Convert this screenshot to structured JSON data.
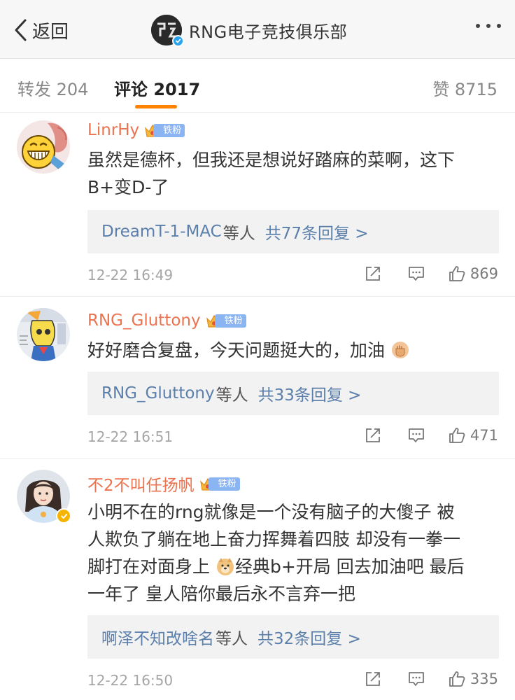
{
  "header": {
    "back_label": "返回",
    "title": "RNG电子竞技俱乐部",
    "avatar_text": "⨼",
    "more_icon": "ellipsis-icon"
  },
  "tabs": {
    "repost": "转发 204",
    "comment": "评论 2017",
    "likes": "赞 8715",
    "active_color": "#ff8200"
  },
  "colors": {
    "username": "#eb7350",
    "link": "#5b7fab",
    "fan_badge": "#8ab4f2",
    "verified": "#f5b400"
  },
  "comments": [
    {
      "user": "LinrHy",
      "badge": "铁粉",
      "text_lines": [
        "虽然是德杯，但我还是想说好踏麻的菜啊，这下",
        "B+变D-了"
      ],
      "reply_users": "DreamT-1-MAC",
      "reply_etc": "等人",
      "reply_count": "共77条回复 >",
      "time": "12-22 16:49",
      "likes": "869"
    },
    {
      "user": "RNG_Gluttony",
      "badge": "铁粉",
      "text_lines": [
        "好好磨合复盘，今天问题挺大的，加油"
      ],
      "reply_users": "RNG_Gluttony",
      "reply_etc": "等人",
      "reply_count": "共33条回复 >",
      "time": "12-22 16:51",
      "likes": "471"
    },
    {
      "user": "不2不叫任扬帆",
      "badge": "铁粉",
      "text_lines": [
        "小明不在的rng就像是一个没有脑子的大傻子 被",
        "人欺负了躺在地上奋力挥舞着四肢 却没有一拳一",
        "脚打在对面身上",
        "经典b+开局 回去加油吧 最后",
        "一年了 皇人陪你最后永不言弃一把"
      ],
      "reply_users": "啊泽不知改啥名",
      "reply_etc": "等人",
      "reply_count": "共32条回复 >",
      "time": "12-22 16:50",
      "likes": "335"
    }
  ]
}
